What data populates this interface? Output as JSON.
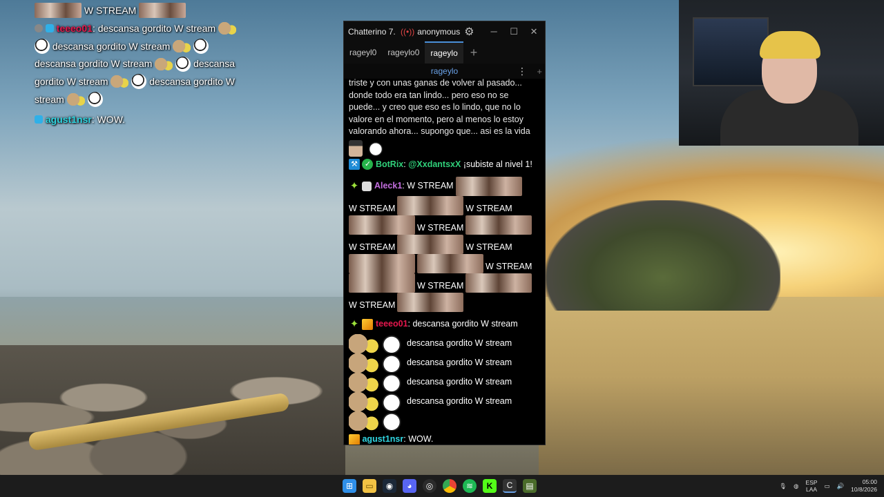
{
  "overlay_chat": {
    "line1_text": "W STREAM",
    "line2_user": "teeeo01",
    "line2_text": "descansa gordito W stream",
    "line3_text": "descansa gordito W stream",
    "line4_text": "descansa gordito W stream",
    "line4b_text": "descansa",
    "line5_text": "gordito W stream",
    "line5b_text": "descansa gordito W",
    "line6_text": "stream",
    "line7_user": "agust1nsr",
    "line7_text": "WOW."
  },
  "chatterino": {
    "app_title": "Chatterino 7.",
    "live_icon": "broadcast-icon",
    "account": "anonymous",
    "window_controls": {
      "minimize": "─",
      "maximize": "☐",
      "close": "✕"
    },
    "tabs": [
      {
        "label": "rageyl0"
      },
      {
        "label": "rageylo0"
      },
      {
        "label": "rageylo",
        "active": true
      }
    ],
    "add_tab": "+",
    "split_channel": "rageylo",
    "split_menu": "⋮",
    "split_add": "+",
    "messages": {
      "long_text": "triste y con unas ganas de volver al pasado... donde todo era tan lindo... pero eso no se puede... y creo que eso es lo lindo, que no lo valore en el momento, pero al menos lo estoy valorando ahora... supongo que... asi es la vida",
      "botrix_user": "BotRix",
      "botrix_mention": "@XxdantsxX",
      "botrix_text": "¡subiste al nivel 1!",
      "aleck_user": "Aleck1",
      "w_stream": "W STREAM",
      "teee_user": "teeeo01",
      "teee_text": "descansa gordito W stream",
      "repeat_text": "descansa gordito W stream",
      "agust_user": "agust1nsr",
      "agust_text": "WOW."
    }
  },
  "taskbar": {
    "icons": [
      "windows-start-icon",
      "file-explorer-icon",
      "steam-icon",
      "discord-icon",
      "obs-icon",
      "chrome-icon",
      "spotify-icon",
      "kick-icon",
      "chatterino-icon",
      "terminal-icon"
    ],
    "lang_top": "ESP",
    "lang_bottom": "LAA",
    "time": "05:00",
    "date": "10/8/2026"
  },
  "colors": {
    "accent_tab": "#4a90d9",
    "teee_name": "#e5174d",
    "agust_name": "#2fd6e2",
    "botrix_name": "#30d07a",
    "aleck_name": "#c46ee0"
  }
}
